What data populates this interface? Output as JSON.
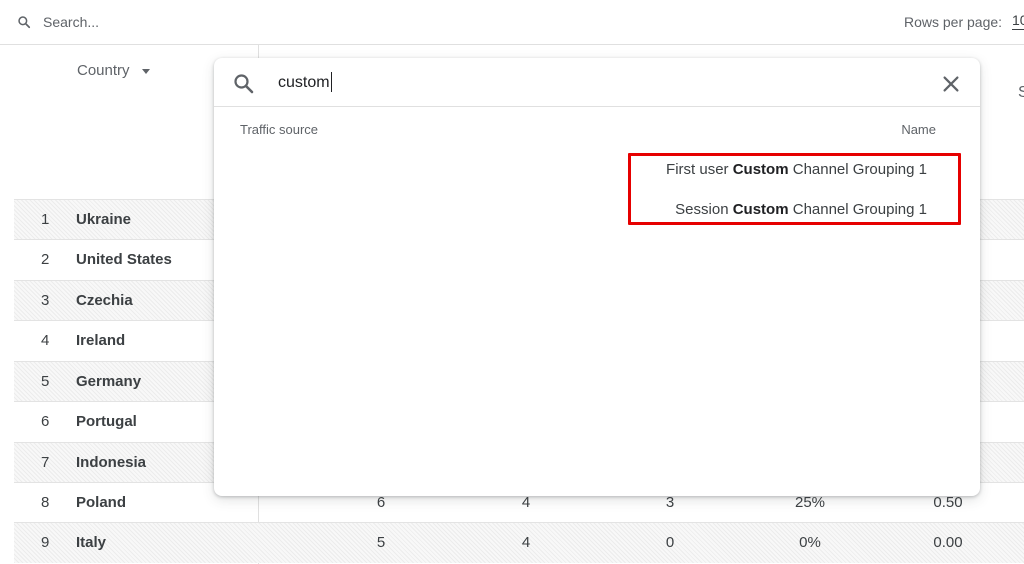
{
  "search": {
    "placeholder": "Search..."
  },
  "pagination": {
    "rows_label": "Rows per page:",
    "rows_value": "10"
  },
  "table": {
    "country_header": "Country",
    "edge_letter": "S",
    "rows": [
      {
        "num": "1",
        "country": "Ukraine"
      },
      {
        "num": "2",
        "country": "United States"
      },
      {
        "num": "3",
        "country": "Czechia"
      },
      {
        "num": "4",
        "country": "Ireland"
      },
      {
        "num": "5",
        "country": "Germany"
      },
      {
        "num": "6",
        "country": "Portugal"
      },
      {
        "num": "7",
        "country": "Indonesia"
      },
      {
        "num": "8",
        "country": "Poland",
        "cells": [
          "6",
          "4",
          "3",
          "25%",
          "0.50"
        ]
      },
      {
        "num": "9",
        "country": "Italy",
        "cells": [
          "5",
          "4",
          "0",
          "0%",
          "0.00"
        ]
      }
    ]
  },
  "dimension_picker": {
    "query": "custom",
    "col_left": "Traffic source",
    "col_right": "Name",
    "results": [
      {
        "prefix": "First user ",
        "match": "Custom",
        "suffix": " Channel Grouping 1"
      },
      {
        "prefix": "Session ",
        "match": "Custom",
        "suffix": " Channel Grouping 1"
      }
    ]
  },
  "colors": {
    "highlight": "#e60000",
    "border": "#e0e0e0",
    "text": "#3c4043"
  },
  "icons": {
    "search": "search-icon",
    "close": "close-icon",
    "sort": "caret-down-icon"
  }
}
